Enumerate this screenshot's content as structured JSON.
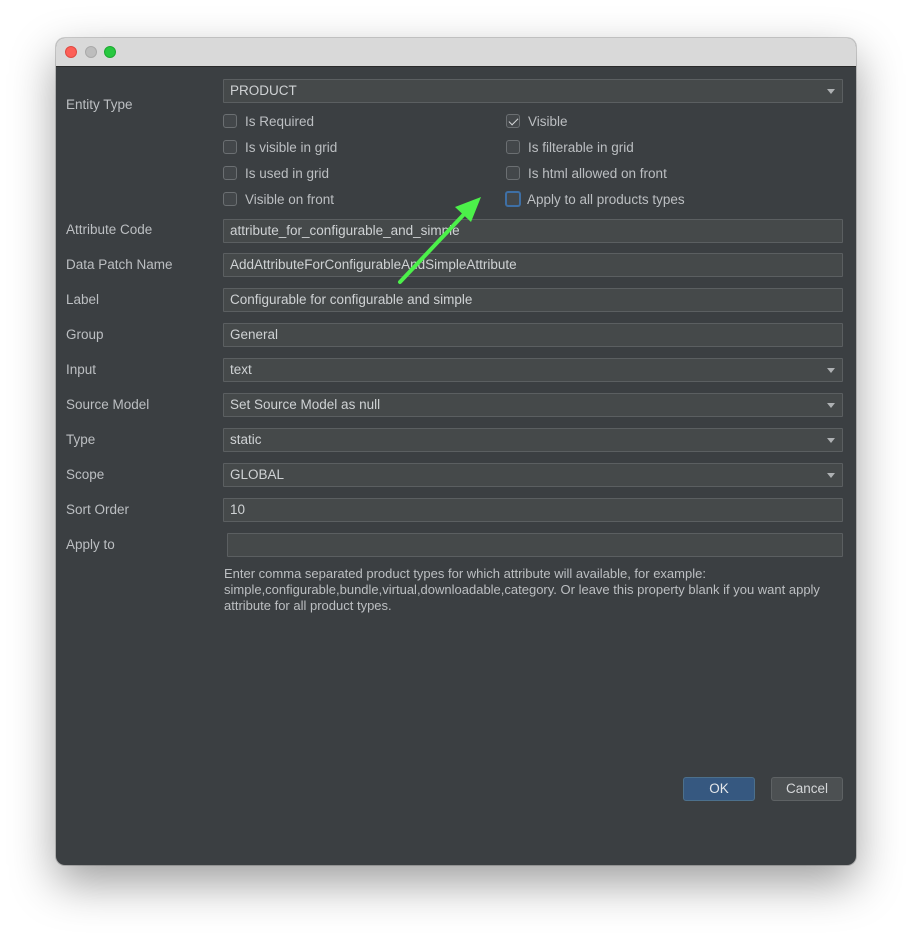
{
  "window": {
    "controls": [
      "close-icon",
      "minimize-icon",
      "maximize-icon"
    ]
  },
  "form": {
    "entity_type": {
      "label": "Entity Type",
      "value": "PRODUCT"
    },
    "checkboxes": {
      "is_required": {
        "label": "Is Required",
        "checked": false
      },
      "visible": {
        "label": "Visible",
        "checked": true
      },
      "is_visible_in_grid": {
        "label": "Is visible in grid",
        "checked": false
      },
      "is_filterable_in_grid": {
        "label": "Is filterable in grid",
        "checked": false
      },
      "is_used_in_grid": {
        "label": "Is used in grid",
        "checked": false
      },
      "is_html_allowed_on_front": {
        "label": "Is html allowed on front",
        "checked": false
      },
      "visible_on_front": {
        "label": "Visible on front",
        "checked": false
      },
      "apply_to_all_products_types": {
        "label": "Apply to all products types",
        "checked": false
      }
    },
    "attribute_code": {
      "label": "Attribute Code",
      "value": "attribute_for_configurable_and_simple"
    },
    "data_patch_name": {
      "label": "Data Patch Name",
      "value": "AddAttributeForConfigurableAndSimpleAttribute"
    },
    "label_field": {
      "label": "Label",
      "value": "Configurable for configurable and simple"
    },
    "group": {
      "label": "Group",
      "value": "General"
    },
    "input": {
      "label": "Input",
      "value": "text"
    },
    "source_model": {
      "label": "Source Model",
      "value": "Set Source Model as null"
    },
    "type": {
      "label": "Type",
      "value": "static"
    },
    "scope": {
      "label": "Scope",
      "value": "GLOBAL"
    },
    "sort_order": {
      "label": "Sort Order",
      "value": "10"
    },
    "apply_to": {
      "label": "Apply to",
      "value": ""
    },
    "hint": "Enter comma separated product types for which attribute will available, for example: simple,configurable,bundle,virtual,downloadable,category. Or leave this property blank if you want apply attribute for all product types."
  },
  "buttons": {
    "ok": "OK",
    "cancel": "Cancel"
  },
  "annotation": {
    "arrow_color": "#4cf04a"
  }
}
